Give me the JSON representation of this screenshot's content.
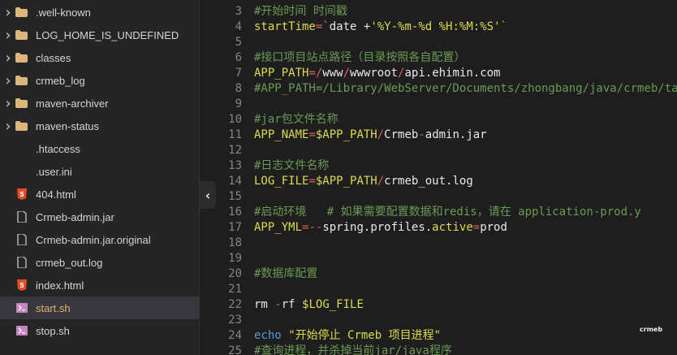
{
  "sidebar": {
    "items": [
      {
        "label": ".well-known",
        "type": "folder",
        "icon": "folder-icon"
      },
      {
        "label": "LOG_HOME_IS_UNDEFINED",
        "type": "folder",
        "icon": "folder-icon"
      },
      {
        "label": "classes",
        "type": "folder",
        "icon": "folder-icon"
      },
      {
        "label": "crmeb_log",
        "type": "folder",
        "icon": "folder-icon"
      },
      {
        "label": "maven-archiver",
        "type": "folder",
        "icon": "folder-icon"
      },
      {
        "label": "maven-status",
        "type": "folder",
        "icon": "folder-icon"
      },
      {
        "label": ".htaccess",
        "type": "file",
        "icon": ""
      },
      {
        "label": ".user.ini",
        "type": "file",
        "icon": ""
      },
      {
        "label": "404.html",
        "type": "file",
        "icon": "html5-icon"
      },
      {
        "label": "Crmeb-admin.jar",
        "type": "file",
        "icon": "file-icon"
      },
      {
        "label": "Crmeb-admin.jar.original",
        "type": "file",
        "icon": "file-icon"
      },
      {
        "label": "crmeb_out.log",
        "type": "file",
        "icon": "file-icon"
      },
      {
        "label": "index.html",
        "type": "file",
        "icon": "html5-icon"
      },
      {
        "label": "start.sh",
        "type": "file",
        "icon": "shell-icon",
        "selected": true
      },
      {
        "label": "stop.sh",
        "type": "file",
        "icon": "shell-icon"
      }
    ]
  },
  "editor": {
    "lines": [
      {
        "num": "3",
        "tokens": [
          {
            "t": "#开始时间 时间戳",
            "c": "comment"
          }
        ]
      },
      {
        "num": "4",
        "tokens": [
          {
            "t": "startTime",
            "c": "key"
          },
          {
            "t": "=",
            "c": "op"
          },
          {
            "t": "`",
            "c": "str"
          },
          {
            "t": "date +",
            "c": "text"
          },
          {
            "t": "'%Y-%m-%d %H:%M:%S'",
            "c": "strlit"
          },
          {
            "t": "`",
            "c": "str"
          }
        ]
      },
      {
        "num": "5",
        "tokens": []
      },
      {
        "num": "6",
        "tokens": [
          {
            "t": "#接口项目站点路径（目录按照各自配置）",
            "c": "comment"
          }
        ]
      },
      {
        "num": "7",
        "tokens": [
          {
            "t": "APP_PATH",
            "c": "key"
          },
          {
            "t": "=/",
            "c": "op"
          },
          {
            "t": "www",
            "c": "text"
          },
          {
            "t": "/",
            "c": "op"
          },
          {
            "t": "wwwroot",
            "c": "text"
          },
          {
            "t": "/",
            "c": "op"
          },
          {
            "t": "api.ehimin.com",
            "c": "text"
          }
        ]
      },
      {
        "num": "8",
        "tokens": [
          {
            "t": "#APP_PATH=/Library/WebServer/Documents/zhongbang/java/crmeb/ta",
            "c": "comment"
          }
        ]
      },
      {
        "num": "9",
        "tokens": []
      },
      {
        "num": "10",
        "tokens": [
          {
            "t": "#jar包文件名称",
            "c": "comment"
          }
        ]
      },
      {
        "num": "11",
        "tokens": [
          {
            "t": "APP_NAME",
            "c": "key"
          },
          {
            "t": "=",
            "c": "op"
          },
          {
            "t": "$APP_PATH",
            "c": "var"
          },
          {
            "t": "/",
            "c": "op"
          },
          {
            "t": "Crmeb",
            "c": "text"
          },
          {
            "t": "-",
            "c": "op"
          },
          {
            "t": "admin.jar",
            "c": "text"
          }
        ]
      },
      {
        "num": "12",
        "tokens": []
      },
      {
        "num": "13",
        "tokens": [
          {
            "t": "#日志文件名称",
            "c": "comment"
          }
        ]
      },
      {
        "num": "14",
        "tokens": [
          {
            "t": "LOG_FILE",
            "c": "key"
          },
          {
            "t": "=",
            "c": "op"
          },
          {
            "t": "$APP_PATH",
            "c": "var"
          },
          {
            "t": "/",
            "c": "op"
          },
          {
            "t": "crmeb_out.log",
            "c": "text"
          }
        ]
      },
      {
        "num": "15",
        "tokens": []
      },
      {
        "num": "16",
        "tokens": [
          {
            "t": "#启动环境   # 如果需要配置数据和redis，请在 application-prod.y",
            "c": "comment"
          }
        ]
      },
      {
        "num": "17",
        "tokens": [
          {
            "t": "APP_YML",
            "c": "key"
          },
          {
            "t": "=--",
            "c": "op"
          },
          {
            "t": "spring.profiles.",
            "c": "text"
          },
          {
            "t": "active",
            "c": "var"
          },
          {
            "t": "=",
            "c": "op"
          },
          {
            "t": "prod",
            "c": "text"
          }
        ]
      },
      {
        "num": "18",
        "tokens": []
      },
      {
        "num": "19",
        "tokens": []
      },
      {
        "num": "20",
        "tokens": [
          {
            "t": "#数据库配置",
            "c": "comment"
          }
        ]
      },
      {
        "num": "21",
        "tokens": []
      },
      {
        "num": "22",
        "tokens": [
          {
            "t": "rm ",
            "c": "cmd"
          },
          {
            "t": "-",
            "c": "op"
          },
          {
            "t": "rf ",
            "c": "text"
          },
          {
            "t": "$LOG_FILE",
            "c": "var"
          }
        ]
      },
      {
        "num": "23",
        "tokens": []
      },
      {
        "num": "24",
        "tokens": [
          {
            "t": "echo ",
            "c": "kw"
          },
          {
            "t": "\"开始停止 Crmeb 项目进程\"",
            "c": "strlit"
          }
        ]
      },
      {
        "num": "25",
        "tokens": [
          {
            "t": "#查询进程，并杀掉当前jar/java程序",
            "c": "comment"
          }
        ]
      }
    ]
  },
  "collapse_glyph": "‹",
  "watermark": "crmeb",
  "colors": {
    "sidebar_bg": "#252526",
    "editor_bg": "#1e1e1e",
    "folder": "#dcb67a",
    "html5": "#e44d26",
    "shell": "#c586c0",
    "selected_text": "#e0b36b"
  }
}
